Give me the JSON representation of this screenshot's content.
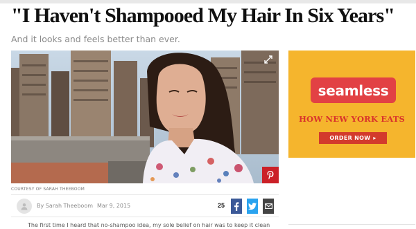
{
  "article": {
    "headline": "\"I Haven't Shampooed My Hair In Six Years\"",
    "dek": "And it looks and feels better than ever.",
    "photo_credit": "COURTESY OF SARAH THEEBOOM",
    "author": "By Sarah Theeboom",
    "date": "Mar 9, 2015",
    "share_count": "25",
    "body_preview": "The first time I heard that no-shampoo idea, my sole belief on hair was to keep it clean",
    "icons": {
      "expand": "expand-icon",
      "pinterest": "pinterest-icon",
      "avatar": "user-avatar-icon",
      "facebook": "facebook-icon",
      "twitter": "twitter-icon",
      "email": "email-icon"
    }
  },
  "ad": {
    "brand": "seamless",
    "tagline": "HOW NEW YORK EATS",
    "cta": "ORDER NOW",
    "cta_arrow": "▸"
  },
  "colors": {
    "ad_background": "#f5b52d",
    "ad_red": "#e24144",
    "facebook": "#3b5998",
    "twitter": "#2aa3ef",
    "pinterest": "#cb2027"
  }
}
